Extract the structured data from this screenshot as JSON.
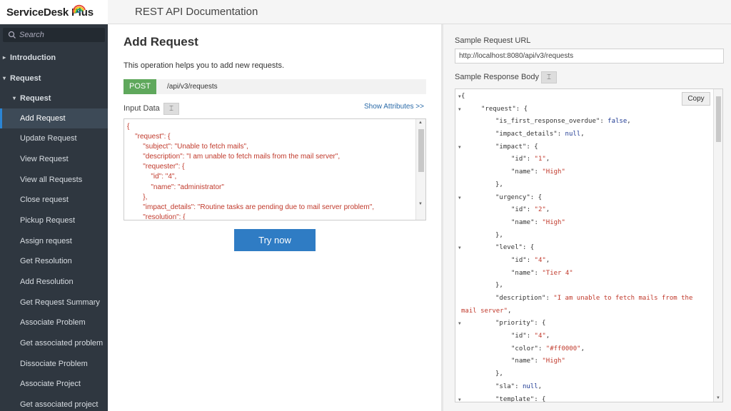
{
  "app": {
    "name": "ServiceDesk Plus",
    "title": "REST API Documentation"
  },
  "search": {
    "placeholder": "Search"
  },
  "sidebar": {
    "items": [
      {
        "label": "Introduction",
        "level": 0,
        "arrow": "▸"
      },
      {
        "label": "Request",
        "level": 0,
        "arrow": "▾"
      },
      {
        "label": "Request",
        "level": 1,
        "arrow": "▾"
      },
      {
        "label": "Add Request",
        "level": 2,
        "active": true
      },
      {
        "label": "Update Request",
        "level": 2
      },
      {
        "label": "View Request",
        "level": 2
      },
      {
        "label": "View all Requests",
        "level": 2
      },
      {
        "label": "Close request",
        "level": 2
      },
      {
        "label": "Pickup Request",
        "level": 2
      },
      {
        "label": "Assign request",
        "level": 2
      },
      {
        "label": "Get Resolution",
        "level": 2
      },
      {
        "label": "Add Resolution",
        "level": 2
      },
      {
        "label": "Get Request Summary",
        "level": 2
      },
      {
        "label": "Associate Problem",
        "level": 2
      },
      {
        "label": "Get associated problem",
        "level": 2
      },
      {
        "label": "Dissociate Problem",
        "level": 2
      },
      {
        "label": "Associate Project",
        "level": 2
      },
      {
        "label": "Get associated project",
        "level": 2
      }
    ]
  },
  "main": {
    "title": "Add Request",
    "description": "This operation helps you to add new requests.",
    "method": "POST",
    "endpoint": "/api/v3/requests",
    "input_label": "Input Data",
    "show_attributes": "Show Attributes >>",
    "try_button": "Try now",
    "input_code": [
      "{",
      "    \"request\": {",
      "        \"subject\": \"Unable to fetch mails\",",
      "        \"description\": \"I am unable to fetch mails from the mail server\",",
      "        \"requester\": {",
      "            \"id\": \"4\",",
      "            \"name\": \"administrator\"",
      "        },",
      "        \"impact_details\": \"Routine tasks are pending due to mail server problem\",",
      "        \"resolution\": {"
    ]
  },
  "right": {
    "url_label": "Sample Request URL",
    "url": "http://localhost:8080/api/v3/requests",
    "response_label": "Sample Response Body",
    "copy_label": "Copy",
    "response_lines": [
      {
        "indent": 0,
        "text": "{",
        "toggle": true
      },
      {
        "indent": 1,
        "text": "\"request\": {",
        "toggle": true
      },
      {
        "indent": 2,
        "text": "\"is_first_response_overdue\": false,"
      },
      {
        "indent": 2,
        "text": "\"impact_details\": null,"
      },
      {
        "indent": 2,
        "text": "\"impact\": {",
        "toggle": true
      },
      {
        "indent": 3,
        "text": "\"id\": \"1\","
      },
      {
        "indent": 3,
        "text": "\"name\": \"High\""
      },
      {
        "indent": 2,
        "text": "},"
      },
      {
        "indent": 2,
        "text": "\"urgency\": {",
        "toggle": true
      },
      {
        "indent": 3,
        "text": "\"id\": \"2\","
      },
      {
        "indent": 3,
        "text": "\"name\": \"High\""
      },
      {
        "indent": 2,
        "text": "},"
      },
      {
        "indent": 2,
        "text": "\"level\": {",
        "toggle": true
      },
      {
        "indent": 3,
        "text": "\"id\": \"4\","
      },
      {
        "indent": 3,
        "text": "\"name\": \"Tier 4\""
      },
      {
        "indent": 2,
        "text": "},"
      },
      {
        "indent": 2,
        "text": "\"description\": \"I am unable to fetch mails from the"
      },
      {
        "indent": -1,
        "text": "mail server\","
      },
      {
        "indent": 2,
        "text": "\"priority\": {",
        "toggle": true
      },
      {
        "indent": 3,
        "text": "\"id\": \"4\","
      },
      {
        "indent": 3,
        "text": "\"color\": \"#ff0000\","
      },
      {
        "indent": 3,
        "text": "\"name\": \"High\""
      },
      {
        "indent": 2,
        "text": "},"
      },
      {
        "indent": 2,
        "text": "\"sla\": null,"
      },
      {
        "indent": 2,
        "text": "\"template\": {",
        "toggle": true
      }
    ]
  },
  "colors": {
    "sidebar_bg": "#2f3740",
    "active_accent": "#2b85d4",
    "post_badge": "#5fa85c",
    "try_button": "#2f7cc4",
    "json_key": "#333333",
    "json_string": "#c0392b",
    "json_literal": "#1f3a93"
  },
  "icons": {
    "search": "search-icon",
    "format": "format-icon",
    "logo": "swirl-logo-icon"
  }
}
